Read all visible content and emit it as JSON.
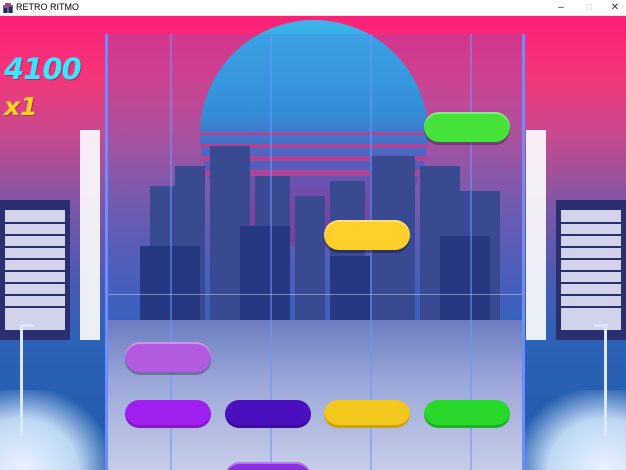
{
  "window": {
    "title": "RETRO RITMO",
    "minimize_glyph": "–",
    "maximize_glyph": "□",
    "close_glyph": "✕"
  },
  "hud": {
    "score": "4100",
    "multiplier": "x1"
  },
  "colors": {
    "lane_purple": "#a020f0",
    "lane_indigo": "#4a10c0",
    "lane_yellow": "#f2c81c",
    "lane_green": "#28d82a",
    "note_purple": "#b25ae0",
    "note_yellow": "#ffd02a",
    "note_green": "#45e23a",
    "score": "#38e8ff",
    "multiplier": "#ffd21c"
  },
  "lanes": [
    "purple",
    "indigo",
    "yellow",
    "green"
  ],
  "notes": [
    {
      "lane": 4,
      "color": "green"
    },
    {
      "lane": 3,
      "color": "yellow"
    },
    {
      "lane": 1,
      "color": "purple"
    },
    {
      "lane": 2,
      "color": "indigo"
    }
  ]
}
